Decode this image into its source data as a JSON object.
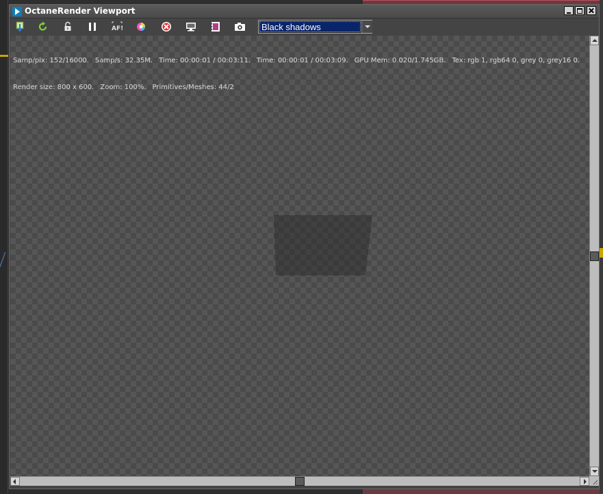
{
  "window": {
    "title": "OctaneRender Viewport"
  },
  "toolbar": {
    "buttons": [
      {
        "name": "send-scene-icon"
      },
      {
        "name": "restart-render-icon"
      },
      {
        "name": "lock-icon"
      },
      {
        "name": "pause-icon"
      },
      {
        "name": "afi-focus-icon"
      },
      {
        "name": "color-picker-icon"
      },
      {
        "name": "stop-render-icon"
      },
      {
        "name": "display-settings-icon"
      },
      {
        "name": "film-region-icon"
      },
      {
        "name": "camera-icon"
      }
    ],
    "afi_label": "AF!",
    "quality_select": {
      "selected": "Black shadows"
    }
  },
  "stats": {
    "line1": [
      "Samp/pix: 152/16000.",
      "Samp/s: 32.35M.",
      "Time: 00:00:01 / 00:03:11.",
      "Time: 00:00:01 / 00:03:09.",
      "GPU Mem: 0.020/1.745GB.",
      "Tex: rgb 1, rgb64 0, grey 0, grey16 0."
    ],
    "line2": [
      "Render size: 800 x 600.",
      "Zoom: 100%.",
      "Primitives/Meshes: 44/2"
    ]
  },
  "colors": {
    "selection_blue": "#0a246a",
    "app_icon": "#0e7fb5"
  }
}
